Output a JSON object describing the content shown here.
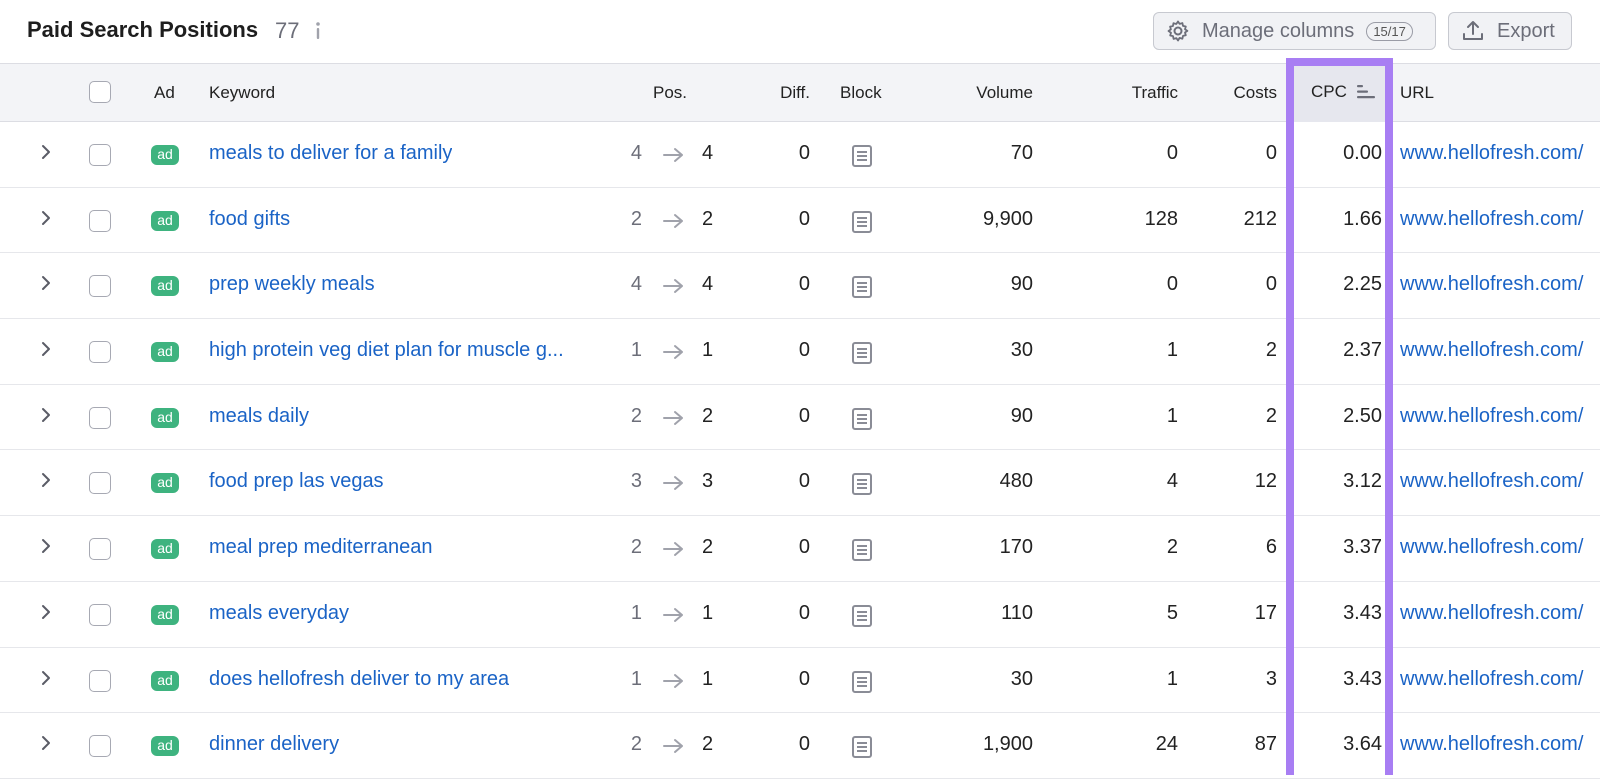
{
  "header": {
    "title": "Paid Search Positions",
    "count": "77",
    "manage_columns": {
      "label": "Manage columns",
      "badge": "15/17",
      "icon": "gear-icon"
    },
    "export": {
      "label": "Export",
      "icon": "upload-icon"
    }
  },
  "columns": {
    "ad": "Ad",
    "keyword": "Keyword",
    "pos": "Pos.",
    "diff": "Diff.",
    "block": "Block",
    "volume": "Volume",
    "traffic": "Traffic",
    "costs": "Costs",
    "cpc": "CPC",
    "url": "URL"
  },
  "sort": {
    "column": "cpc",
    "direction": "ascending"
  },
  "highlight_color": "#a87ef3",
  "rows": [
    {
      "ad": "ad",
      "keyword": "meals to deliver for a family",
      "pos_prev": "4",
      "pos": "4",
      "diff": "0",
      "volume": "70",
      "traffic": "0",
      "costs": "0",
      "cpc": "0.00",
      "url": "www.hellofresh.com/"
    },
    {
      "ad": "ad",
      "keyword": "food gifts",
      "pos_prev": "2",
      "pos": "2",
      "diff": "0",
      "volume": "9,900",
      "traffic": "128",
      "costs": "212",
      "cpc": "1.66",
      "url": "www.hellofresh.com/"
    },
    {
      "ad": "ad",
      "keyword": "prep weekly meals",
      "pos_prev": "4",
      "pos": "4",
      "diff": "0",
      "volume": "90",
      "traffic": "0",
      "costs": "0",
      "cpc": "2.25",
      "url": "www.hellofresh.com/"
    },
    {
      "ad": "ad",
      "keyword": "high protein veg diet plan for muscle g...",
      "pos_prev": "1",
      "pos": "1",
      "diff": "0",
      "volume": "30",
      "traffic": "1",
      "costs": "2",
      "cpc": "2.37",
      "url": "www.hellofresh.com/"
    },
    {
      "ad": "ad",
      "keyword": "meals daily",
      "pos_prev": "2",
      "pos": "2",
      "diff": "0",
      "volume": "90",
      "traffic": "1",
      "costs": "2",
      "cpc": "2.50",
      "url": "www.hellofresh.com/"
    },
    {
      "ad": "ad",
      "keyword": "food prep las vegas",
      "pos_prev": "3",
      "pos": "3",
      "diff": "0",
      "volume": "480",
      "traffic": "4",
      "costs": "12",
      "cpc": "3.12",
      "url": "www.hellofresh.com/"
    },
    {
      "ad": "ad",
      "keyword": "meal prep mediterranean",
      "pos_prev": "2",
      "pos": "2",
      "diff": "0",
      "volume": "170",
      "traffic": "2",
      "costs": "6",
      "cpc": "3.37",
      "url": "www.hellofresh.com/"
    },
    {
      "ad": "ad",
      "keyword": "meals everyday",
      "pos_prev": "1",
      "pos": "1",
      "diff": "0",
      "volume": "110",
      "traffic": "5",
      "costs": "17",
      "cpc": "3.43",
      "url": "www.hellofresh.com/"
    },
    {
      "ad": "ad",
      "keyword": "does hellofresh deliver to my area",
      "pos_prev": "1",
      "pos": "1",
      "diff": "0",
      "volume": "30",
      "traffic": "1",
      "costs": "3",
      "cpc": "3.43",
      "url": "www.hellofresh.com/"
    },
    {
      "ad": "ad",
      "keyword": "dinner delivery",
      "pos_prev": "2",
      "pos": "2",
      "diff": "0",
      "volume": "1,900",
      "traffic": "24",
      "costs": "87",
      "cpc": "3.64",
      "url": "www.hellofresh.com/"
    }
  ]
}
